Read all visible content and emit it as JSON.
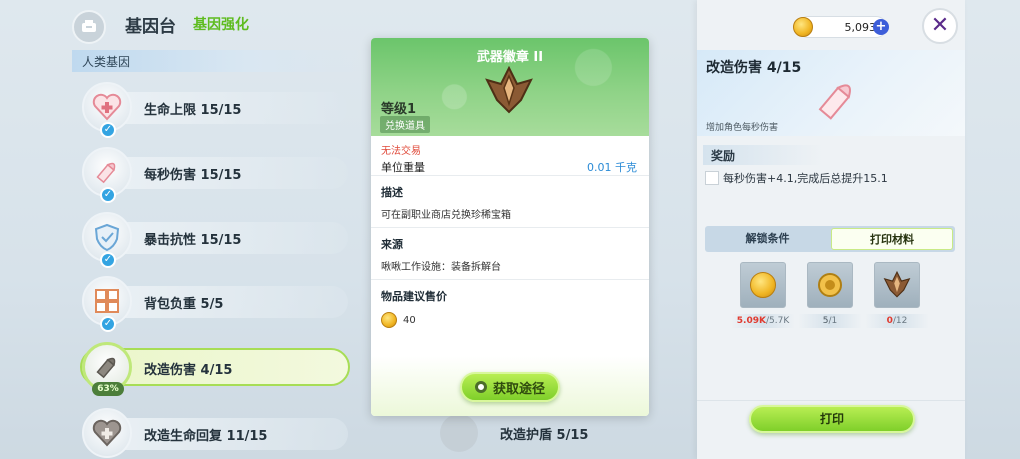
{
  "header": {
    "title": "基因台",
    "subtitle": "基因强化"
  },
  "section_label": "人类基因",
  "genes": [
    {
      "label": "生命上限 15/15",
      "icon": "heart-plus-icon",
      "checked": true
    },
    {
      "label": "每秒伤害 15/15",
      "icon": "bullet-icon",
      "checked": true
    },
    {
      "label": "暴击抗性 15/15",
      "icon": "shield-icon",
      "checked": true
    },
    {
      "label": "背包负重 5/5",
      "icon": "backpack-grid-icon",
      "checked": true
    },
    {
      "label": "改造伤害 4/15",
      "icon": "bullet-icon",
      "progress": "63%",
      "selected": true
    },
    {
      "label": "改造生命回复 11/15",
      "icon": "heart-cross-icon"
    }
  ],
  "faded_items": [
    {
      "label": "改造护盾 5/15"
    }
  ],
  "item_popup": {
    "title": "武器徽章 II",
    "level": "等级1",
    "tag": "兑换道具",
    "untradable": "无法交易",
    "weight_label": "单位重量",
    "weight_value": "0.01 千克",
    "desc_heading": "描述",
    "desc_text": "可在副职业商店兑换珍稀宝箱",
    "source_heading": "来源",
    "source_text": "啾啾工作设施：装备拆解台",
    "price_heading": "物品建议售价",
    "price_value": "40",
    "get_button": "获取途径"
  },
  "right_panel": {
    "currency": "5,093",
    "title": "改造伤害 4/15",
    "description": "增加角色每秒伤害",
    "reward_heading": "奖励",
    "reward_text": "每秒伤害+4.1,完成后总提升15.1",
    "tabs": [
      "解锁条件",
      "打印材料"
    ],
    "active_tab": "打印材料",
    "materials": [
      {
        "icon": "gold-coin-icon",
        "have": "5.09K",
        "need": "/5.7K",
        "sufficient": false
      },
      {
        "icon": "gear-coin-icon",
        "have": "5",
        "need": "/1",
        "sufficient": true
      },
      {
        "icon": "badge-icon",
        "have": "0",
        "need": "/12",
        "sufficient": false
      }
    ],
    "print_button": "打印"
  },
  "colors": {
    "accent_green": "#7fcf2a",
    "check_blue": "#33a4e2",
    "warning_red": "#e03a2f",
    "popup_header_green": "#6bc56b"
  }
}
